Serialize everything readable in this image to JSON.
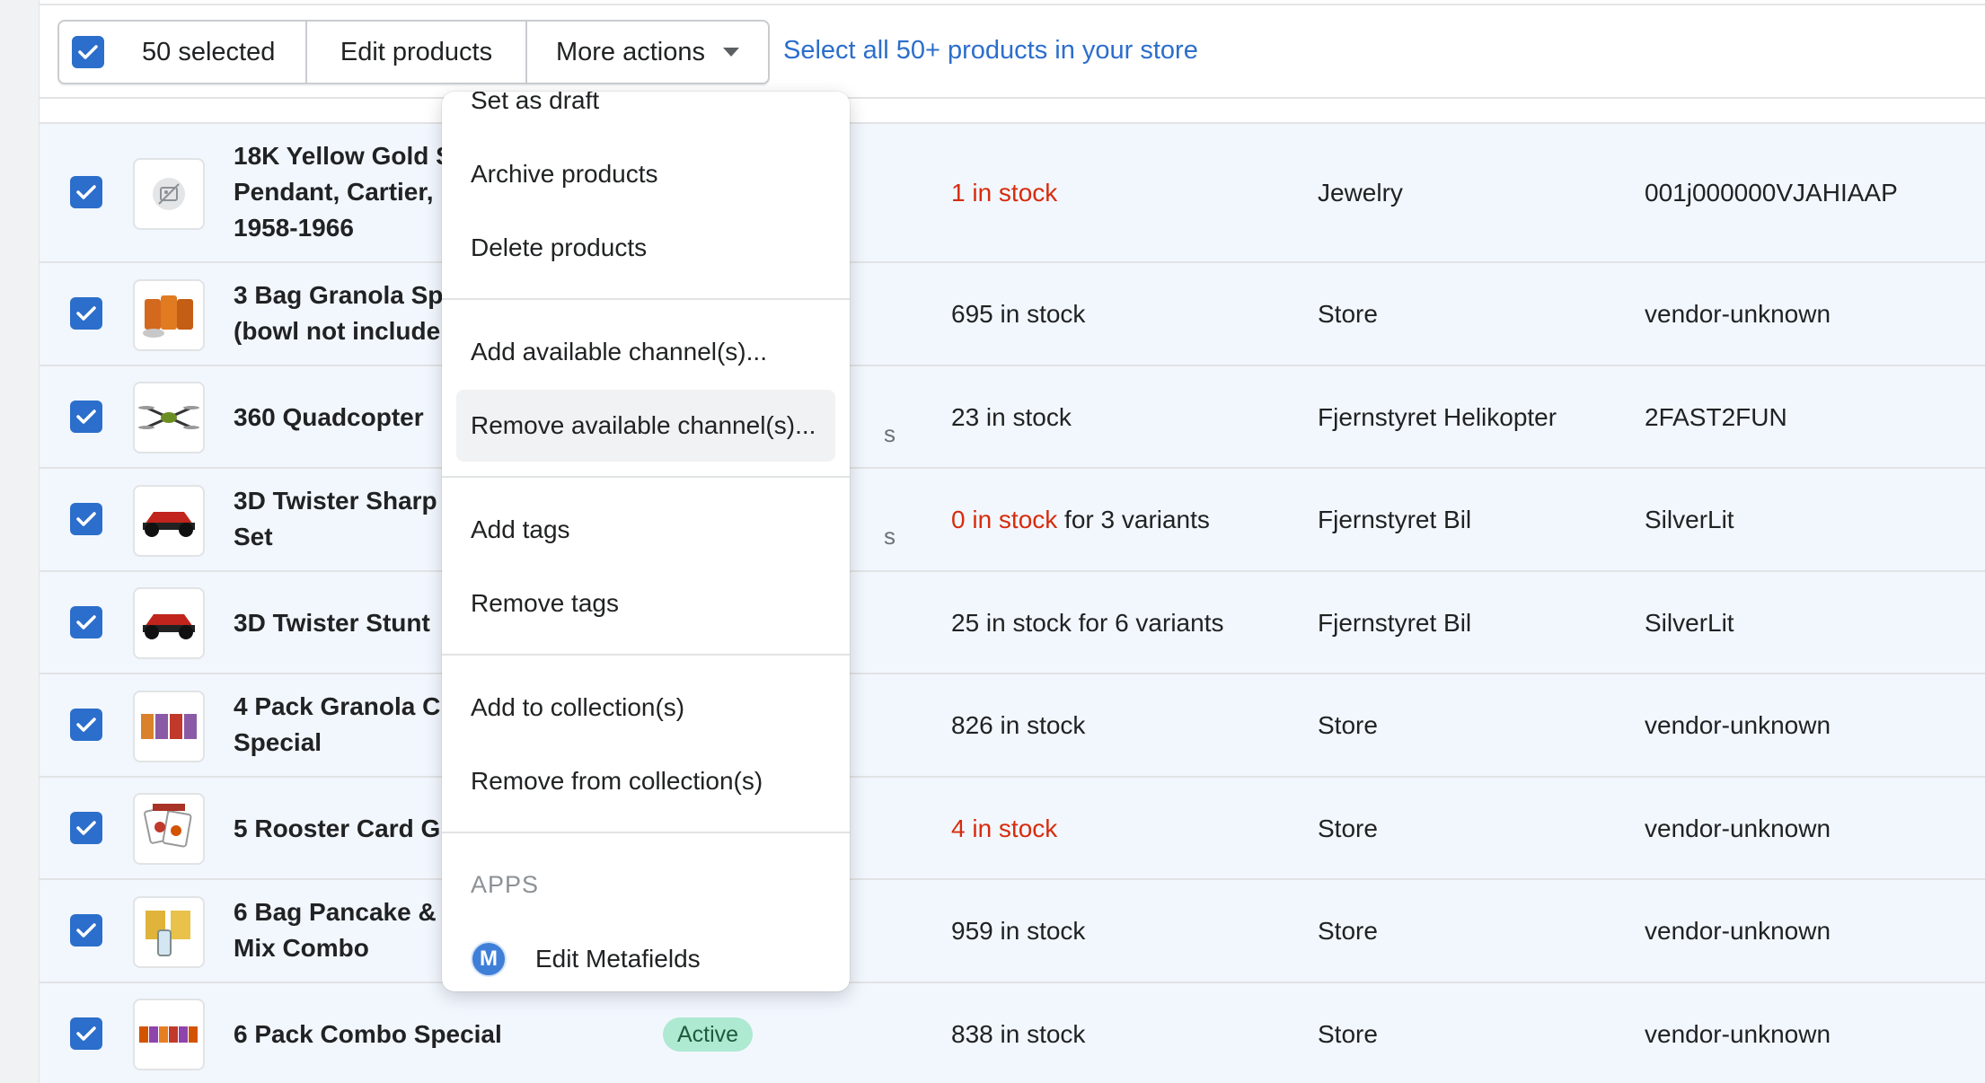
{
  "bulk_bar": {
    "selected_label": "50 selected",
    "edit_products_label": "Edit products",
    "more_actions_label": "More actions",
    "select_all_link": "Select all 50+ products in your store"
  },
  "more_actions_menu": {
    "items_group1": [
      "Set as draft",
      "Archive products",
      "Delete products"
    ],
    "items_group2": [
      "Add available channel(s)...",
      "Remove available channel(s)..."
    ],
    "items_group3": [
      "Add tags",
      "Remove tags"
    ],
    "items_group4": [
      "Add to collection(s)",
      "Remove from collection(s)"
    ],
    "apps_header": "APPS",
    "app_item": {
      "icon_letter": "M",
      "label": "Edit Metafields"
    },
    "hovered_item": "Remove available channel(s)..."
  },
  "rows": [
    {
      "title": "18K Yellow Gold S Pendant, Cartier, 1958-1966",
      "title_lines": [
        "18K Yellow Gold S",
        "Pendant, Cartier,",
        "1958-1966"
      ],
      "inventory": "1 in stock",
      "inventory_red": true,
      "inventory_suffix": "",
      "type": "Jewelry",
      "vendor": "001j000000VJAHIAAP",
      "thumb_icon": "placeholder-image-icon"
    },
    {
      "title_lines": [
        "3 Bag Granola Sp",
        "(bowl not include"
      ],
      "inventory": "695 in stock",
      "inventory_red": false,
      "inventory_suffix": "",
      "type": "Store",
      "vendor": "vendor-unknown",
      "thumb_icon": "granola-bags-icon"
    },
    {
      "title_lines": [
        "360 Quadcopter"
      ],
      "inventory": "23 in stock",
      "inventory_red": false,
      "inventory_suffix": "",
      "type": "Fjernstyret Helikopter",
      "vendor": "2FAST2FUN",
      "thumb_icon": "quadcopter-icon"
    },
    {
      "title_lines": [
        "3D Twister Sharp",
        "Set"
      ],
      "inventory": "0 in stock",
      "inventory_red": true,
      "inventory_suffix": " for 3 variants",
      "type": "Fjernstyret Bil",
      "vendor": "SilverLit",
      "thumb_icon": "rc-car-icon"
    },
    {
      "title_lines": [
        "3D Twister Stunt"
      ],
      "inventory": "25 in stock for 6 variants",
      "inventory_red": false,
      "inventory_suffix": "",
      "type": "Fjernstyret Bil",
      "vendor": "SilverLit",
      "thumb_icon": "rc-car-icon"
    },
    {
      "title_lines": [
        "4 Pack Granola C",
        "Special"
      ],
      "inventory": "826 in stock",
      "inventory_red": false,
      "inventory_suffix": "",
      "type": "Store",
      "vendor": "vendor-unknown",
      "thumb_icon": "granola-packs-icon"
    },
    {
      "title_lines": [
        "5 Rooster Card G"
      ],
      "inventory": "4 in stock",
      "inventory_red": true,
      "inventory_suffix": "",
      "type": "Store",
      "vendor": "vendor-unknown",
      "thumb_icon": "rooster-cards-icon"
    },
    {
      "title_lines": [
        "6 Bag Pancake &",
        "Mix Combo"
      ],
      "inventory": "959 in stock",
      "inventory_red": false,
      "inventory_suffix": "",
      "type": "Store",
      "vendor": "vendor-unknown",
      "thumb_icon": "pancake-mix-icon"
    },
    {
      "title_lines": [
        "6 Pack Combo Special"
      ],
      "status": "Active",
      "inventory": "838 in stock",
      "inventory_red": false,
      "inventory_suffix": "",
      "type": "Store",
      "vendor": "vendor-unknown",
      "thumb_icon": "combo-pack-icon"
    }
  ],
  "colors": {
    "accent": "#2c6ecb",
    "row_selected_bg": "#f2f7fe",
    "stock_red": "#d72c0d",
    "active_badge": "#aee9d1"
  }
}
